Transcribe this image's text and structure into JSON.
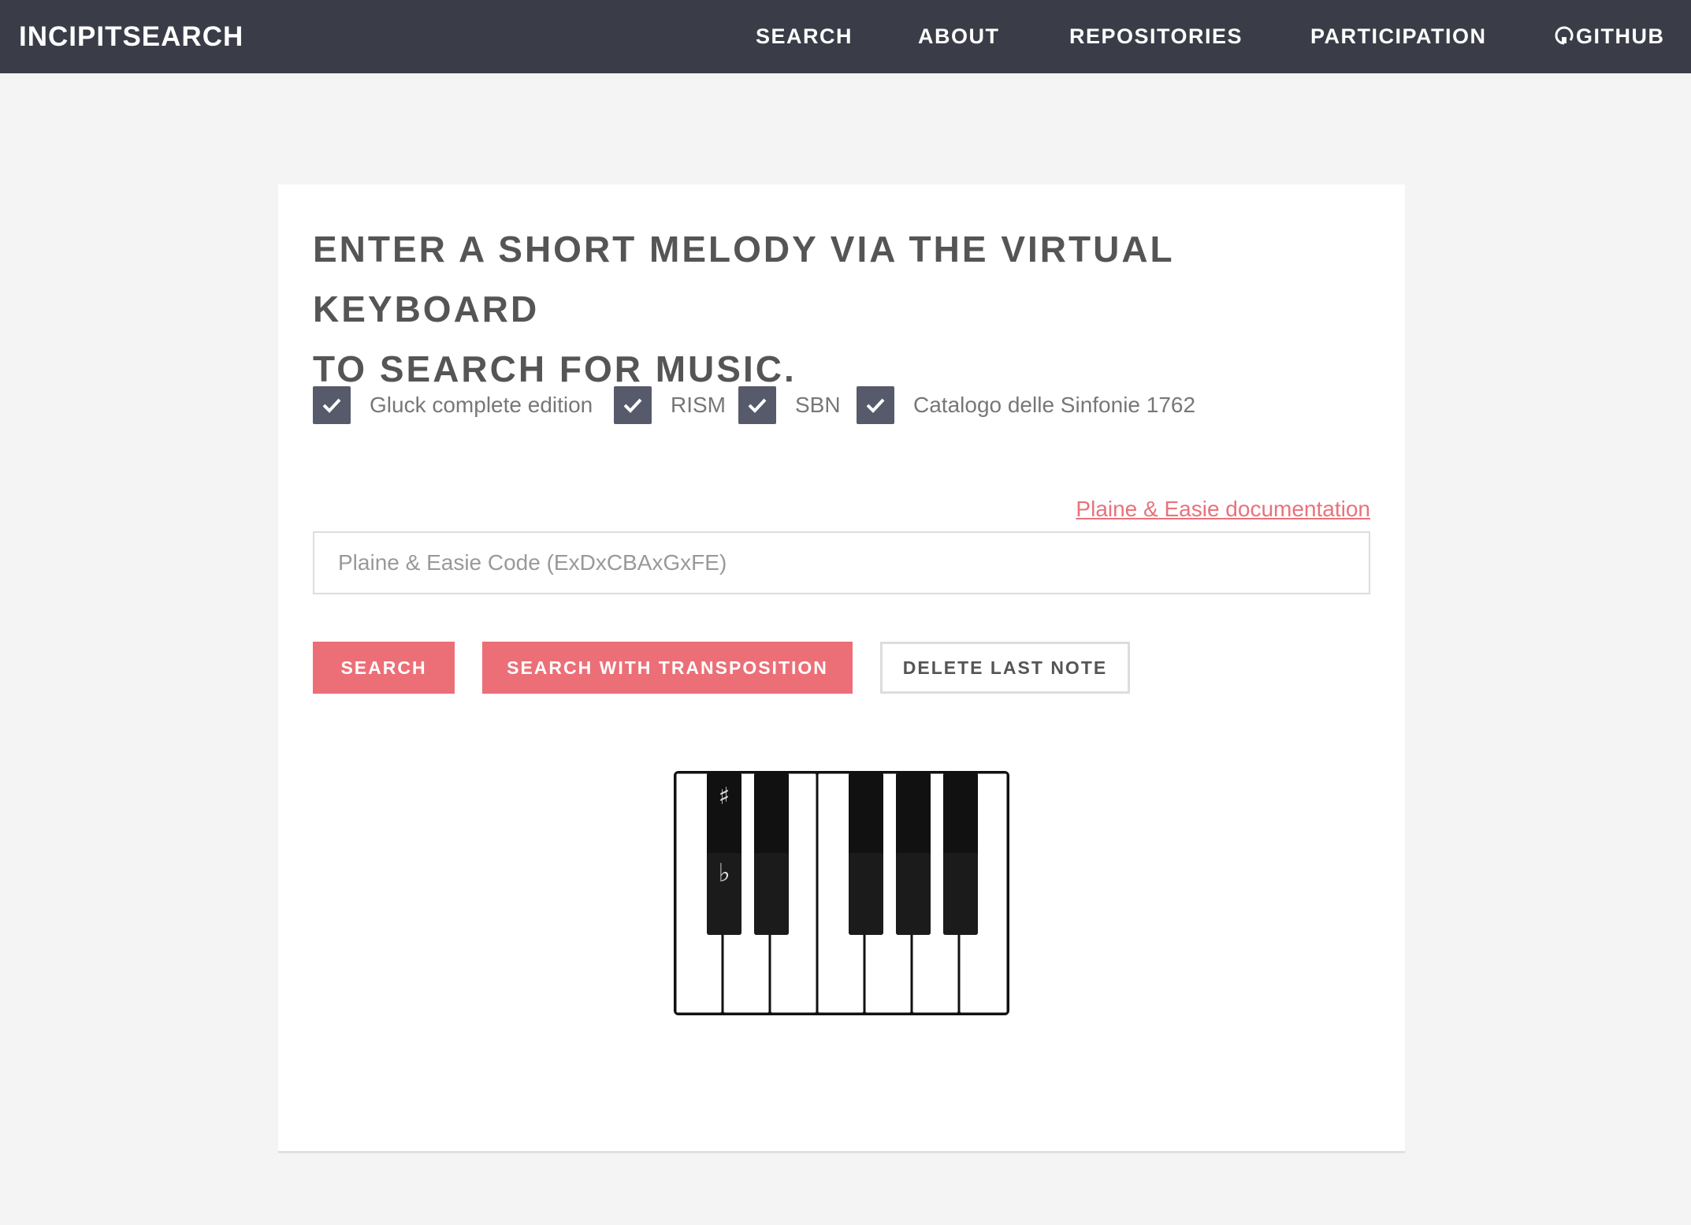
{
  "header": {
    "brand": "INCIPITSEARCH",
    "nav": [
      "SEARCH",
      "ABOUT",
      "REPOSITORIES",
      "PARTICIPATION",
      "GITHUB"
    ]
  },
  "main": {
    "headline_line1": "ENTER A SHORT MELODY VIA THE VIRTUAL KEYBOARD",
    "headline_line2": "TO SEARCH FOR MUSIC.",
    "repositories": [
      {
        "label": "Gluck complete edition",
        "checked": true
      },
      {
        "label": "RISM",
        "checked": true
      },
      {
        "label": "SBN",
        "checked": true
      },
      {
        "label": "Catalogo delle Sinfonie 1762",
        "checked": true
      }
    ],
    "doc_link": "Plaine & Easie documentation",
    "input": {
      "value": "",
      "placeholder": "Plaine & Easie Code (ExDxCBAxGxFE)"
    },
    "buttons": {
      "search": "SEARCH",
      "search_transposition": "SEARCH WITH TRANSPOSITION",
      "delete_last": "DELETE LAST NOTE"
    },
    "keyboard": {
      "sharp_symbol": "♯",
      "flat_symbol": "♭"
    }
  },
  "colors": {
    "header_bg": "#3a3c47",
    "accent": "#ec6f77",
    "checkbox": "#575a6b"
  }
}
